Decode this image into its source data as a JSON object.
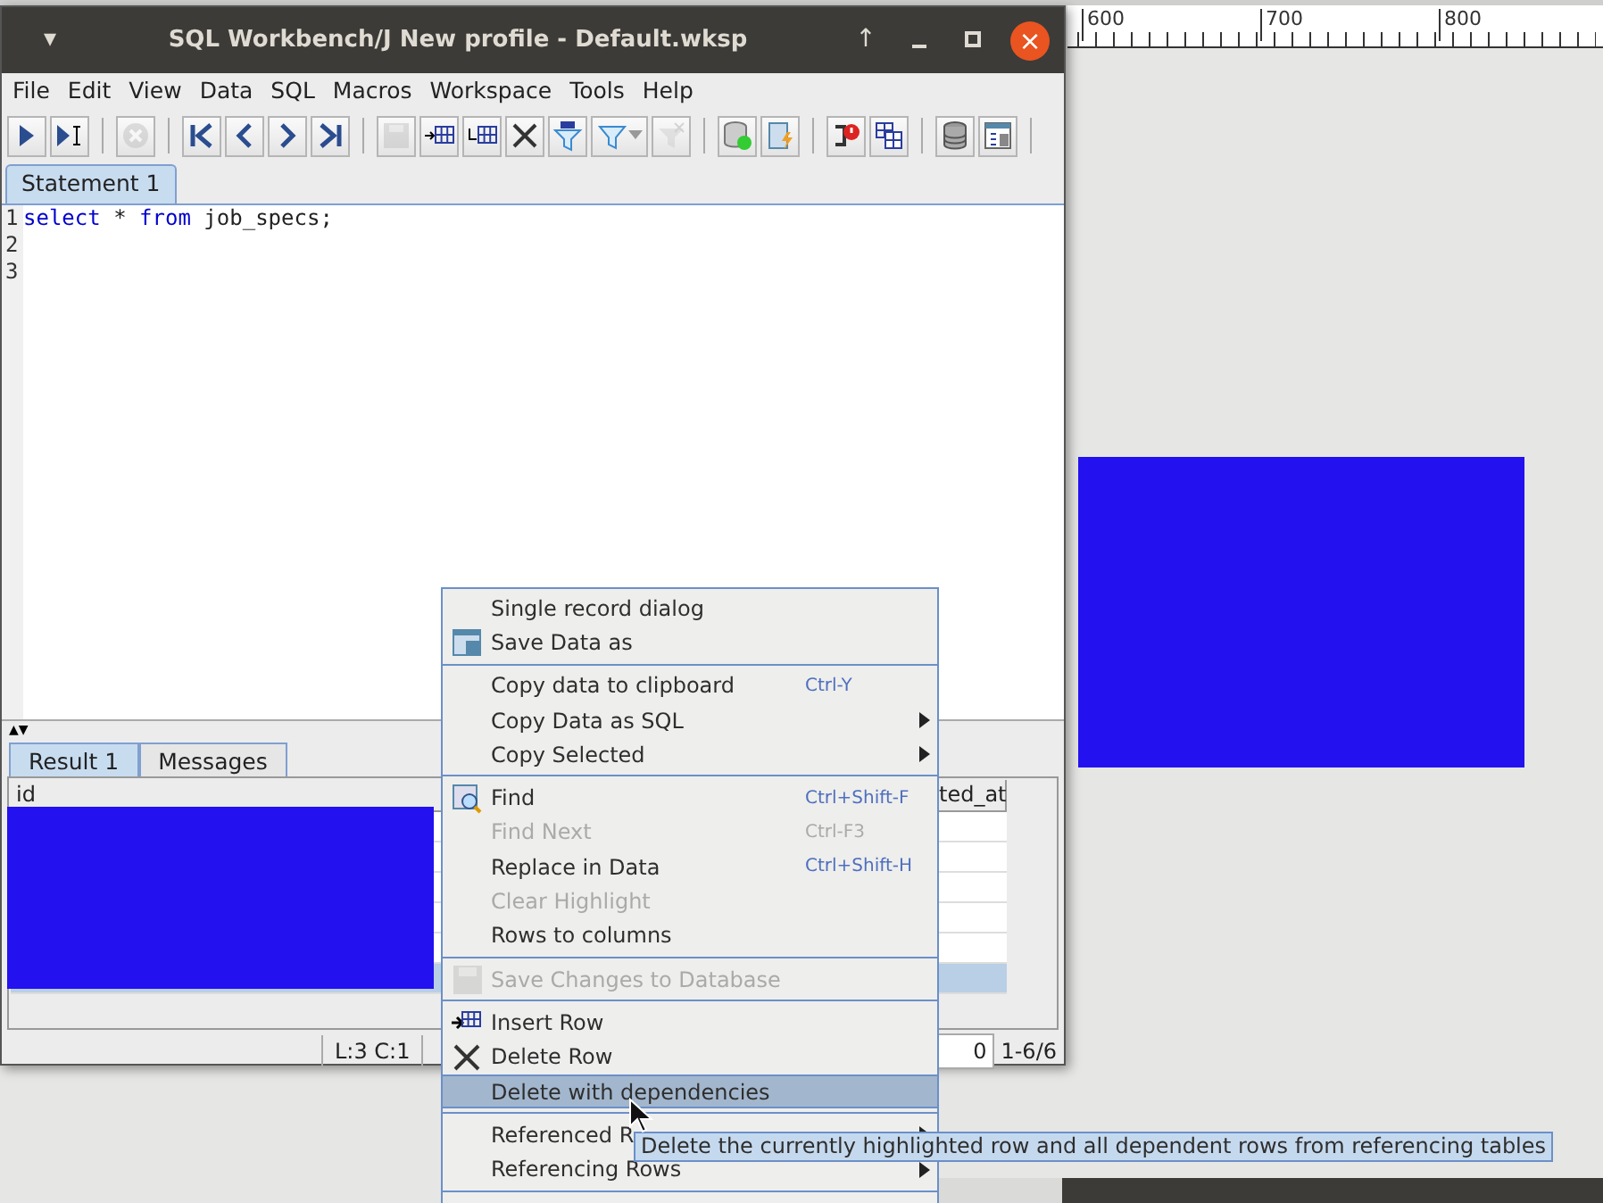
{
  "window": {
    "title": "SQL Workbench/J New profile - Default.wksp",
    "controls": [
      "▾",
      "↑",
      "×"
    ]
  },
  "menubar": [
    {
      "label": "File"
    },
    {
      "label": "Edit"
    },
    {
      "label": "View"
    },
    {
      "label": "Data"
    },
    {
      "label": "SQL"
    },
    {
      "label": "Macros"
    },
    {
      "label": "Workspace"
    },
    {
      "label": "Tools"
    },
    {
      "label": "Help"
    }
  ],
  "toolbar": [
    {
      "kind": "button",
      "disabled": false
    },
    {
      "kind": "button",
      "disabled": false
    },
    {
      "kind": "separator"
    },
    {
      "kind": "button",
      "disabled": true
    },
    {
      "kind": "separator"
    },
    {
      "kind": "button",
      "disabled": false
    },
    {
      "kind": "button",
      "disabled": false
    },
    {
      "kind": "button",
      "disabled": false
    },
    {
      "kind": "button",
      "disabled": false
    },
    {
      "kind": "separator"
    },
    {
      "kind": "button",
      "disabled": true
    },
    {
      "kind": "button",
      "disabled": false
    },
    {
      "kind": "button",
      "disabled": false
    },
    {
      "kind": "button",
      "disabled": false
    },
    {
      "kind": "button",
      "disabled": false
    },
    {
      "kind": "dropdown",
      "disabled": false
    },
    {
      "kind": "button",
      "disabled": true
    },
    {
      "kind": "separator"
    },
    {
      "kind": "button",
      "disabled": false
    },
    {
      "kind": "button",
      "disabled": false
    },
    {
      "kind": "separator"
    },
    {
      "kind": "button",
      "disabled": false
    },
    {
      "kind": "button",
      "disabled": false
    },
    {
      "kind": "separator"
    },
    {
      "kind": "button",
      "disabled": false
    },
    {
      "kind": "button",
      "disabled": false
    },
    {
      "kind": "separator"
    }
  ],
  "editor_tabs": [
    {
      "label": "Statement 1",
      "selected": true
    }
  ],
  "editor": {
    "line_numbers": [
      "1",
      "2",
      "3"
    ],
    "lines": [
      [
        {
          "text": "select",
          "kind": "keyword"
        },
        {
          "text": " * ",
          "kind": "plain"
        },
        {
          "text": "from",
          "kind": "keyword"
        },
        {
          "text": " job_specs;",
          "kind": "plain"
        }
      ]
    ]
  },
  "splitter_arrows": [
    "▲",
    "▼"
  ],
  "result_tabs": [
    {
      "label": "Result 1",
      "selected": true
    },
    {
      "label": "Messages",
      "selected": false
    }
  ],
  "table": {
    "columns": [
      {
        "label": "id"
      },
      {
        "label": "ted_at"
      }
    ],
    "rows": [
      {
        "selected": false
      },
      {
        "selected": false
      },
      {
        "selected": false
      },
      {
        "selected": false
      },
      {
        "selected": false
      },
      {
        "selected": true
      }
    ]
  },
  "status_bar": {
    "position": "L:3 C:1",
    "count": "0",
    "rows": "1-6/6"
  },
  "context_menu": [
    {
      "kind": "item",
      "label": "Single record dialog",
      "disabled": false,
      "selected": false
    },
    {
      "kind": "item",
      "label": "Save Data as",
      "disabled": false,
      "selected": false
    },
    {
      "kind": "separator"
    },
    {
      "kind": "item",
      "label": "Copy data to clipboard",
      "shortcut": "Ctrl-Y",
      "disabled": false,
      "selected": false
    },
    {
      "kind": "submenu",
      "label": "Copy Data as SQL",
      "disabled": false,
      "selected": false
    },
    {
      "kind": "submenu",
      "label": "Copy Selected",
      "disabled": false,
      "selected": false
    },
    {
      "kind": "separator"
    },
    {
      "kind": "item",
      "label": "Find",
      "shortcut": "Ctrl+Shift-F",
      "disabled": false,
      "selected": false
    },
    {
      "kind": "item",
      "label": "Find Next",
      "shortcut": "Ctrl-F3",
      "disabled": true,
      "selected": false
    },
    {
      "kind": "item",
      "label": "Replace in Data",
      "shortcut": "Ctrl+Shift-H",
      "disabled": false,
      "selected": false
    },
    {
      "kind": "item",
      "label": "Clear Highlight",
      "disabled": true,
      "selected": false
    },
    {
      "kind": "item",
      "label": "Rows to columns",
      "disabled": false,
      "selected": false
    },
    {
      "kind": "separator"
    },
    {
      "kind": "item",
      "label": "Save Changes to Database",
      "disabled": true,
      "selected": false
    },
    {
      "kind": "separator"
    },
    {
      "kind": "item",
      "label": "Insert Row",
      "disabled": false,
      "selected": false
    },
    {
      "kind": "item",
      "label": "Delete Row",
      "disabled": false,
      "selected": false
    },
    {
      "kind": "item",
      "label": "Delete with dependencies",
      "disabled": false,
      "selected": true
    },
    {
      "kind": "separator"
    },
    {
      "kind": "submenu",
      "label": "Referenced R",
      "disabled": false,
      "selected": false
    },
    {
      "kind": "submenu",
      "label": "Referencing Rows",
      "disabled": false,
      "selected": false
    },
    {
      "kind": "separator"
    }
  ],
  "tooltip": "Delete the currently highlighted row and all dependent rows from referencing tables",
  "ruler": {
    "labels": [
      "600",
      "700",
      "800"
    ]
  }
}
